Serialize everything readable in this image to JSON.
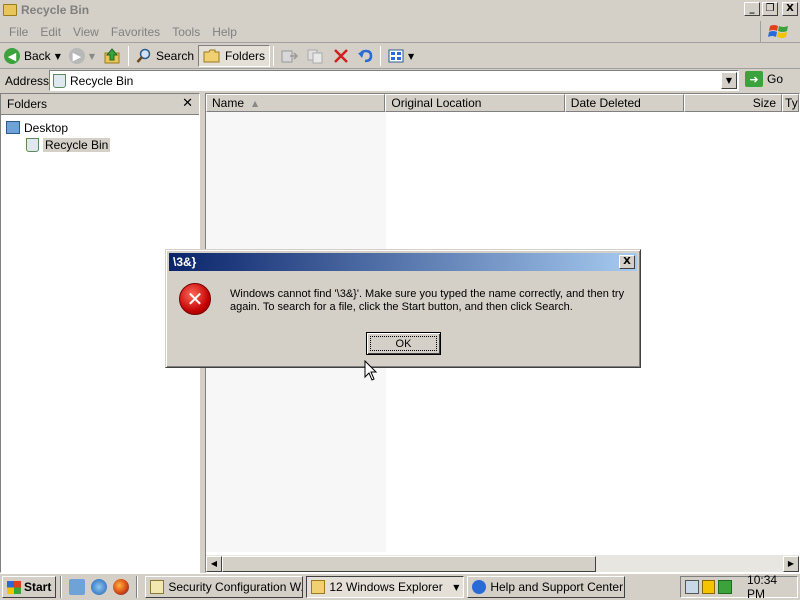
{
  "window": {
    "title": "Recycle Bin",
    "minimize_glyph": "_",
    "restore_glyph": "❐",
    "close_glyph": "X"
  },
  "menubar": {
    "items": [
      "File",
      "Edit",
      "View",
      "Favorites",
      "Tools",
      "Help"
    ]
  },
  "toolbar": {
    "back_label": "Back",
    "search_label": "Search",
    "folders_label": "Folders"
  },
  "address": {
    "label": "Address",
    "value": "Recycle Bin",
    "go_label": "Go"
  },
  "folders_pane": {
    "title": "Folders",
    "close_glyph": "✕",
    "tree": [
      {
        "label": "Desktop",
        "icon": "desktop-icon"
      },
      {
        "label": "Recycle Bin",
        "icon": "recycle-bin-icon",
        "selected": true
      }
    ]
  },
  "list_pane": {
    "columns": [
      "Name",
      "Original Location",
      "Date Deleted",
      "Size",
      "Ty"
    ],
    "sorted_column": "Name"
  },
  "dialog": {
    "title": "\\3&}",
    "message": "Windows cannot find '\\3&}'. Make sure you typed the name correctly, and then try again. To search for a file, click the Start button, and then click Search.",
    "ok_label": "OK",
    "close_glyph": "X"
  },
  "taskbar": {
    "start_label": "Start",
    "tasks": [
      {
        "label": "Security Configuration W...",
        "icon": "security-config-icon"
      },
      {
        "label": "12 Windows Explorer",
        "icon": "folder-icon",
        "grouped": true
      },
      {
        "label": "Help and Support Center",
        "icon": "help-icon"
      }
    ],
    "clock": "10:34 PM"
  },
  "colors": {
    "dialog_title_start": "#0a246a",
    "dialog_title_end": "#a6caf0",
    "error_red": "#c00000",
    "face": "#d4d0c8"
  }
}
